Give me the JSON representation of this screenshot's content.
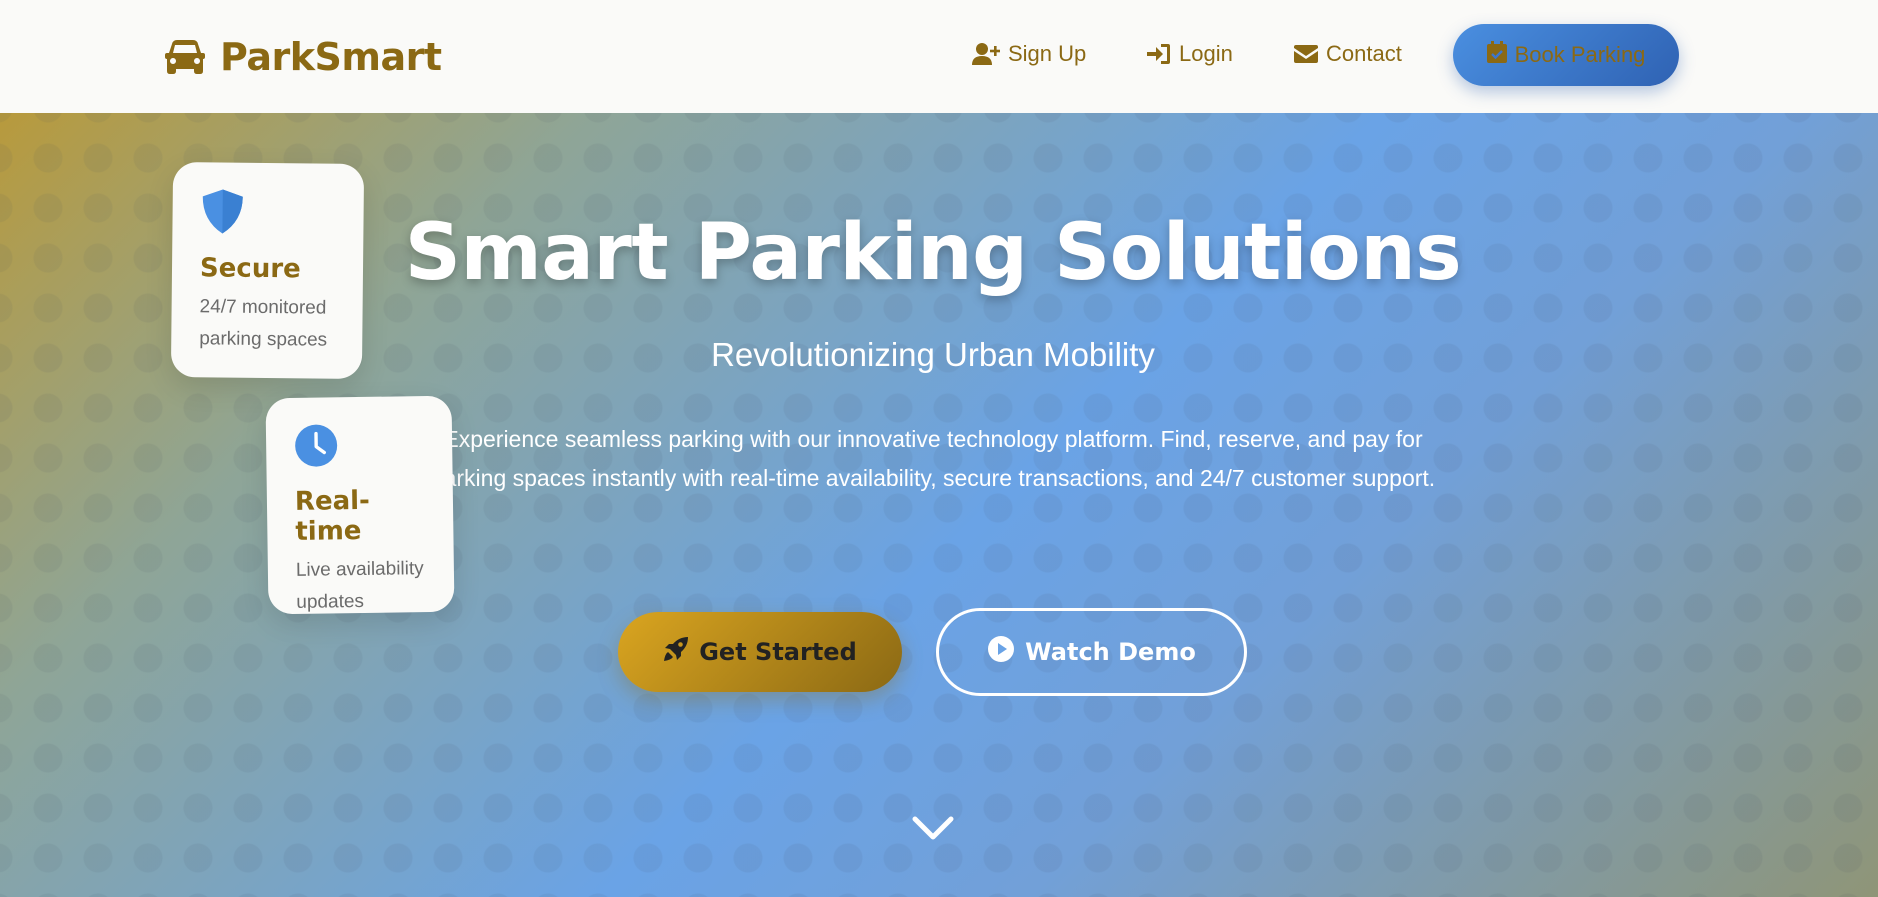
{
  "brand": {
    "name": "ParkSmart",
    "icon": "car-icon"
  },
  "nav": {
    "items": [
      {
        "label": "Sign Up",
        "icon": "user-plus-icon"
      },
      {
        "label": "Login",
        "icon": "sign-in-icon"
      },
      {
        "label": "Contact",
        "icon": "envelope-icon"
      }
    ],
    "cta": {
      "label": "Book Parking",
      "icon": "calendar-check-icon"
    }
  },
  "hero": {
    "title": "Smart Parking Solutions",
    "subtitle": "Revolutionizing Urban Mobility",
    "description": "Experience seamless parking with our innovative technology platform. Find, reserve, and pay for parking spaces instantly with real-time availability, secure transactions, and 24/7 customer support.",
    "primary_button": {
      "label": "Get Started",
      "icon": "rocket-icon"
    },
    "secondary_button": {
      "label": "Watch Demo",
      "icon": "play-circle-icon"
    },
    "scroll_icon": "chevron-down-icon"
  },
  "features": [
    {
      "title": "Secure",
      "text": "24/7 monitored parking spaces",
      "icon": "shield-icon"
    },
    {
      "title": "Real-time",
      "text": "Live availability updates",
      "icon": "clock-icon"
    }
  ],
  "colors": {
    "brand_gold": "#8B6914",
    "accent_blue": "#4a90e2",
    "gold_light": "#daa520",
    "white": "#ffffff"
  }
}
